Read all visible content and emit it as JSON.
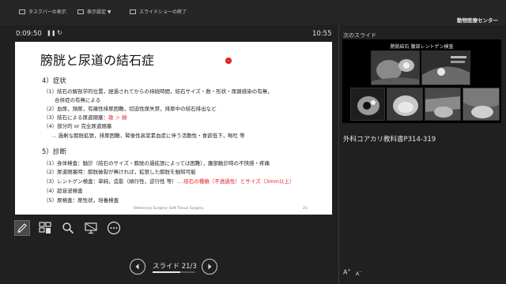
{
  "toolbar": {
    "taskbar_label": "タスクバーの表示",
    "display_settings_label": "表示設定 ▼",
    "end_show_label": "スライドショーの終了",
    "center_name": "動物医療センター"
  },
  "timer": {
    "elapsed": "0:09:50",
    "clock": "10:55"
  },
  "slide": {
    "title": "膀胱と尿道の結石症",
    "section4_heading": "4）症状",
    "lines_section4": [
      "（1）結石の解剖学的位置，経過されてからの持続時間，結石サイズ・数・形状・尿路感染の有無，",
      "合併症の有無による",
      "（2）血尿，頻尿，有痛性排尿困難，切迫性尿失禁，排尿中の結石排出など",
      "（4）部分的 or 完全尿道閉塞",
      "… 過剰な膀胱拡張，排尿困難，腎後性高窒素血症に伴う活動性・食欲低下，嘔吐 等"
    ],
    "line3_prefix": "（3）結石による尿道閉塞：",
    "line3_red": "雄 ＞ 雌",
    "section5_heading": "5）診断",
    "lines_section5": [
      "（1）身体検査：触診（結石のサイズ・膀胱の過拡張によっては困難），腹部触診時の不快感・疼痛",
      "（2）尿道閉塞時：膀胱破裂が無ければ，拡張した膀胱を触知可能",
      "（4）超音波検査",
      "（5）尿検査：尿性状，培養検査"
    ],
    "line3b_prefix": "（3）レントゲン検査：単純，造影（順行性，逆行性 等）… ",
    "line3b_red": "結石の種類（不透過性）とサイズ（3mm以上）",
    "footer_left": "Veterinary Surgery: Soft Tissue Surgery",
    "footer_page": "21"
  },
  "navigation": {
    "slide_counter": "スライド 21/3",
    "progress": 0.65
  },
  "next": {
    "label": "次のスライド",
    "title": "膀胱結石 腹部レントゲン検査"
  },
  "notes": {
    "text": "外科コアカリ教科書P314-319"
  },
  "icons": {
    "pen": "pen-icon",
    "slides": "see-all-slides-icon",
    "zoom": "zoom-icon",
    "screen": "black-screen-icon",
    "more": "more-options-icon"
  },
  "colors": {
    "accent_red": "#e0202a",
    "background": "#202020"
  }
}
